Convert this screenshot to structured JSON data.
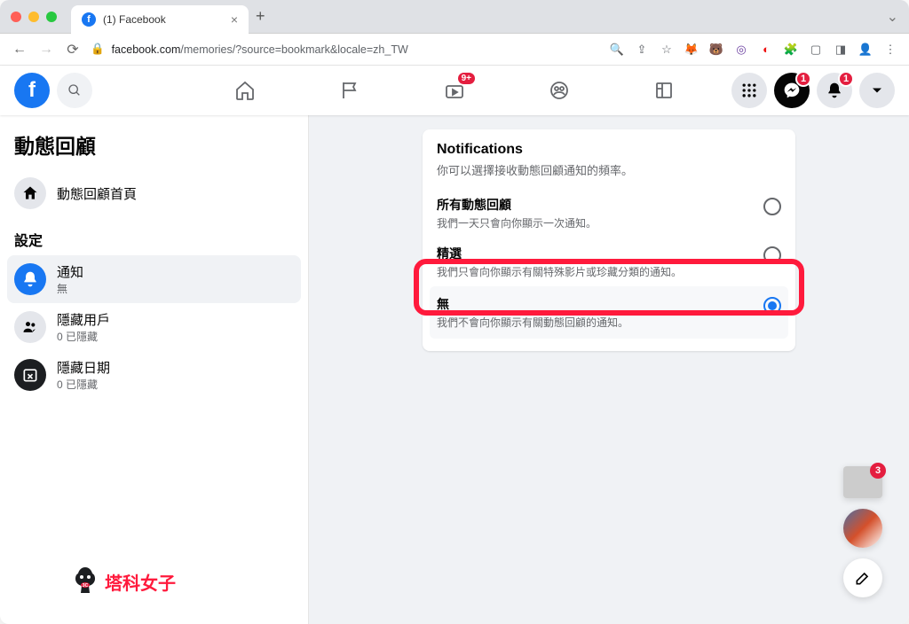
{
  "browser": {
    "tab_title": "(1) Facebook",
    "url_host": "facebook.com",
    "url_path": "/memories/?source=bookmark&locale=zh_TW"
  },
  "header": {
    "watch_badge": "9+",
    "msg_badge": "1",
    "notif_badge": "1"
  },
  "sidebar": {
    "title": "動態回顧",
    "home": "動態回顧首頁",
    "section": "設定",
    "items": [
      {
        "label": "通知",
        "sub": "無"
      },
      {
        "label": "隱藏用戶",
        "sub": "0 已隱藏"
      },
      {
        "label": "隱藏日期",
        "sub": "0 已隱藏"
      }
    ]
  },
  "card": {
    "title": "Notifications",
    "sub": "你可以選擇接收動態回顧通知的頻率。",
    "options": [
      {
        "title": "所有動態回顧",
        "desc": "我們一天只會向你顯示一次通知。"
      },
      {
        "title": "精選",
        "desc": "我們只會向你顯示有關特殊影片或珍藏分類的通知。"
      },
      {
        "title": "無",
        "desc": "我們不會向你顯示有關動態回顧的通知。"
      }
    ]
  },
  "watermark": "塔科女子",
  "float_badge": "3"
}
